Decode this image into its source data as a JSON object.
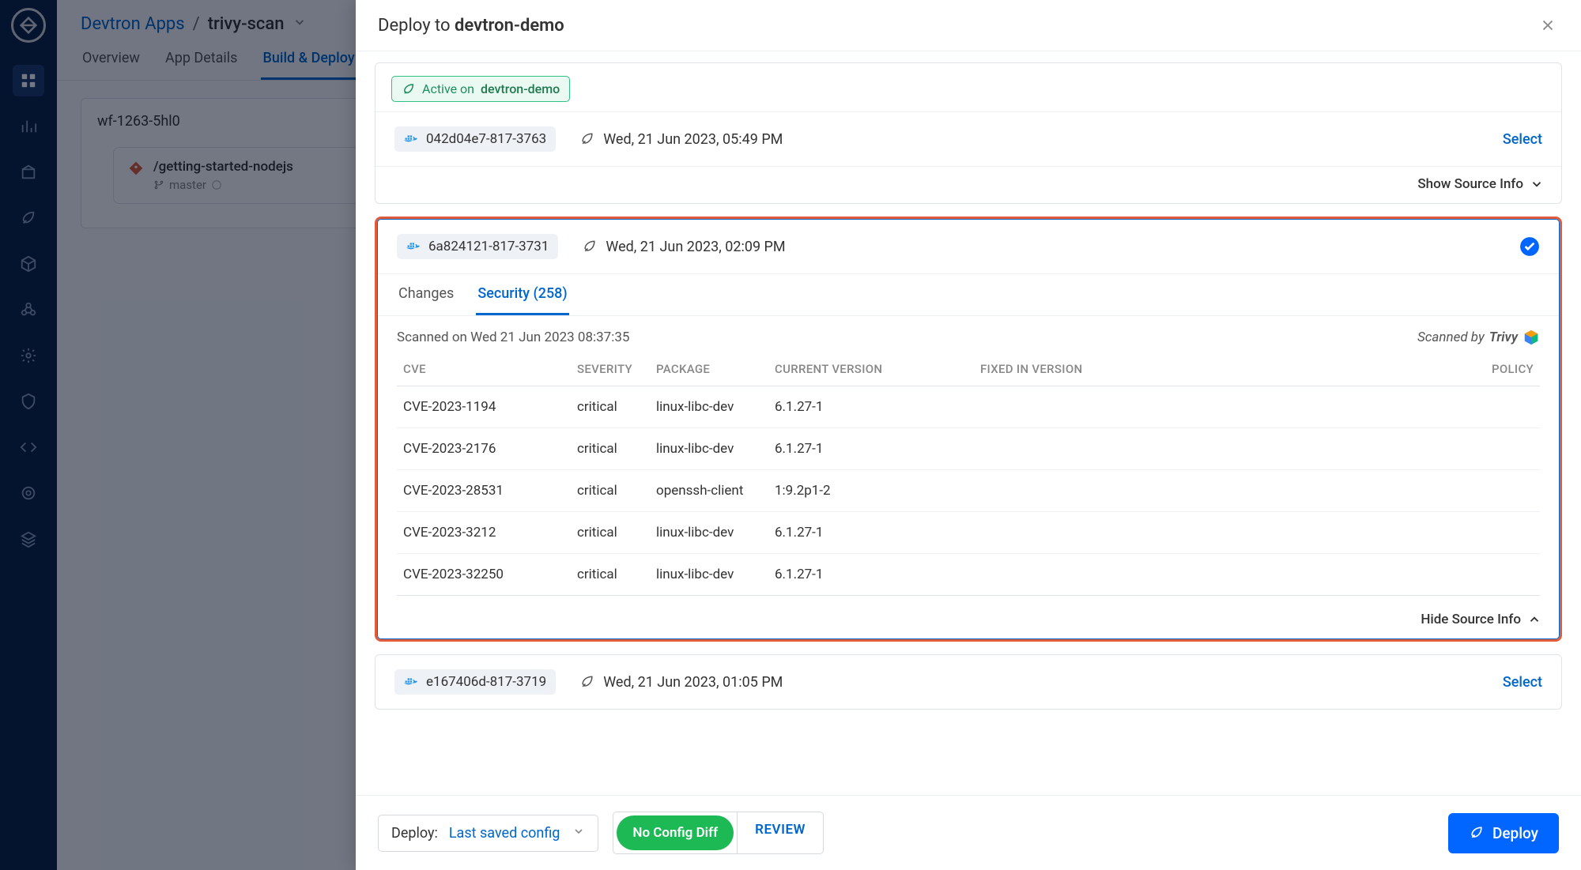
{
  "breadcrumb": {
    "parent": "Devtron Apps",
    "current": "trivy-scan"
  },
  "app_tabs": {
    "overview": "Overview",
    "details": "App Details",
    "build": "Build & Deploy"
  },
  "workflow": {
    "name": "wf-1263-5hl0",
    "source_title": "/getting-started-nodejs",
    "branch": "master"
  },
  "modal": {
    "title_prefix": "Deploy to ",
    "title_env": "devtron-demo",
    "active_label": "Active on",
    "active_env": "devtron-demo",
    "show_source": "Show Source Info",
    "hide_source": "Hide Source Info",
    "select_label": "Select"
  },
  "images": [
    {
      "tag": "042d04e7-817-3763",
      "timestamp": "Wed, 21 Jun 2023, 05:49 PM"
    },
    {
      "tag": "6a824121-817-3731",
      "timestamp": "Wed, 21 Jun 2023, 02:09 PM"
    },
    {
      "tag": "e167406d-817-3719",
      "timestamp": "Wed, 21 Jun 2023, 01:05 PM"
    }
  ],
  "inner_tabs": {
    "changes": "Changes",
    "security": "Security (258)"
  },
  "scan": {
    "scanned_on": "Scanned on Wed 21 Jun 2023 08:37:35",
    "scanned_by_prefix": "Scanned by",
    "scanner": "Trivy"
  },
  "vuln_headers": {
    "cve": "CVE",
    "severity": "SEVERITY",
    "package": "PACKAGE",
    "current": "CURRENT VERSION",
    "fixed": "FIXED IN VERSION",
    "policy": "POLICY"
  },
  "vulnerabilities": [
    {
      "cve": "CVE-2023-1194",
      "severity": "critical",
      "package": "linux-libc-dev",
      "current": "6.1.27-1",
      "fixed": "",
      "policy": ""
    },
    {
      "cve": "CVE-2023-2176",
      "severity": "critical",
      "package": "linux-libc-dev",
      "current": "6.1.27-1",
      "fixed": "",
      "policy": ""
    },
    {
      "cve": "CVE-2023-28531",
      "severity": "critical",
      "package": "openssh-client",
      "current": "1:9.2p1-2",
      "fixed": "",
      "policy": ""
    },
    {
      "cve": "CVE-2023-3212",
      "severity": "critical",
      "package": "linux-libc-dev",
      "current": "6.1.27-1",
      "fixed": "",
      "policy": ""
    },
    {
      "cve": "CVE-2023-32250",
      "severity": "critical",
      "package": "linux-libc-dev",
      "current": "6.1.27-1",
      "fixed": "",
      "policy": ""
    }
  ],
  "footer": {
    "deploy_label": "Deploy:",
    "config_value": "Last saved config",
    "no_diff": "No Config Diff",
    "review": "REVIEW",
    "deploy_btn": "Deploy"
  }
}
